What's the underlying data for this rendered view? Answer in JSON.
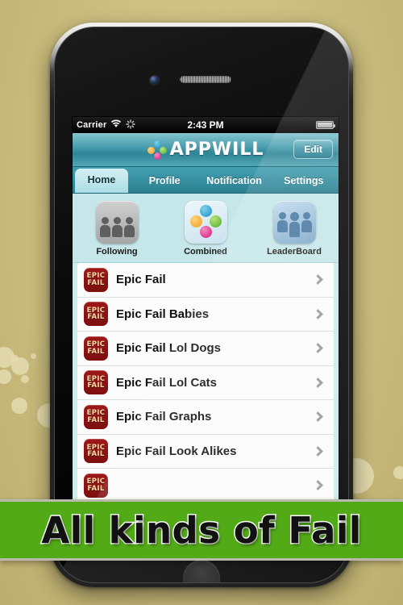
{
  "background": {
    "color": "#cdc081",
    "accent_green": "#52ab16"
  },
  "status_bar": {
    "carrier": "Carrier",
    "wifi_icon": "wifi-icon",
    "activity_icon": "activity-spinner-icon",
    "time": "2:43 PM",
    "battery_icon": "battery-icon"
  },
  "navbar": {
    "logo_text": "APPWILL",
    "logo_icon": "appwill-dots-logo-icon",
    "edit_label": "Edit"
  },
  "tabs": [
    {
      "label": "Home",
      "active": true
    },
    {
      "label": "Profile",
      "active": false
    },
    {
      "label": "Notification",
      "active": false
    },
    {
      "label": "Settings",
      "active": false
    }
  ],
  "shortcuts": [
    {
      "label": "Following",
      "icon": "people-holding-hands-icon"
    },
    {
      "label": "Combined",
      "icon": "four-colored-dots-icon"
    },
    {
      "label": "LeaderBoard",
      "icon": "group-of-people-icon"
    }
  ],
  "list": {
    "icon_line1": "EPIC",
    "icon_line2": "FAIL",
    "rows": [
      {
        "label": "Epic Fail"
      },
      {
        "label": "Epic Fail Babies"
      },
      {
        "label": "Epic Fail Lol Dogs"
      },
      {
        "label": "Epic Fail Lol Cats"
      },
      {
        "label": "Epic Fail Graphs"
      },
      {
        "label": "Epic Fail Look Alikes"
      },
      {
        "label": ""
      }
    ]
  },
  "banner": {
    "text": "All kinds of Fail"
  }
}
